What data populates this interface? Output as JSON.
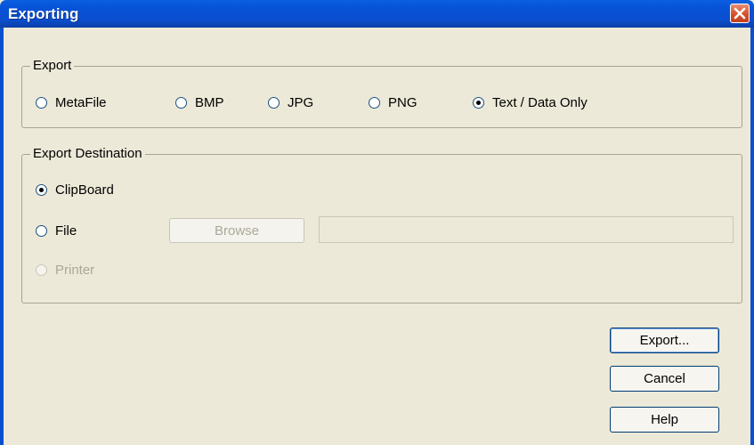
{
  "window": {
    "title": "Exporting",
    "close_icon": "close-icon"
  },
  "export_group": {
    "legend": "Export",
    "options": [
      {
        "label": "MetaFile",
        "checked": false
      },
      {
        "label": "BMP",
        "checked": false
      },
      {
        "label": "JPG",
        "checked": false
      },
      {
        "label": "PNG",
        "checked": false
      },
      {
        "label": "Text / Data Only",
        "checked": true
      }
    ]
  },
  "destination_group": {
    "legend": "Export Destination",
    "clipboard": {
      "label": "ClipBoard",
      "checked": true
    },
    "file": {
      "label": "File",
      "checked": false
    },
    "printer": {
      "label": "Printer",
      "checked": false,
      "disabled": true
    },
    "browse_label": "Browse",
    "file_path_value": ""
  },
  "buttons": {
    "export": "Export...",
    "cancel": "Cancel",
    "help": "Help"
  },
  "colors": {
    "titlebar": "#0a4fd0",
    "dialog_bg": "#ece9d8",
    "close_button": "#d4502c"
  }
}
